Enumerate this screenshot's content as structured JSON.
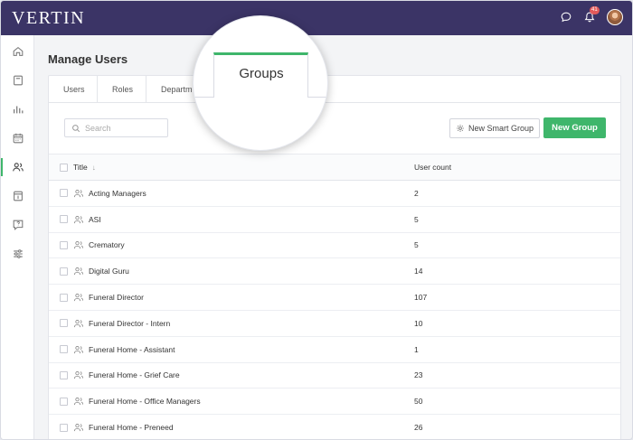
{
  "app": {
    "brand": "VERTIN",
    "notification_count": "41"
  },
  "colors": {
    "topbar": "#3b3466",
    "accent": "#3fb66b"
  },
  "sidebar": {
    "items": [
      {
        "icon": "home-icon",
        "active": false
      },
      {
        "icon": "book-icon",
        "active": false
      },
      {
        "icon": "bar-chart-icon",
        "active": false
      },
      {
        "icon": "calendar-icon",
        "active": false
      },
      {
        "icon": "users-icon",
        "active": true
      },
      {
        "icon": "calendar-day-icon",
        "active": false
      },
      {
        "icon": "help-icon",
        "active": false
      },
      {
        "icon": "sliders-icon",
        "active": false
      }
    ]
  },
  "page": {
    "title": "Manage Users"
  },
  "tabs": [
    {
      "label": "Users"
    },
    {
      "label": "Roles"
    },
    {
      "label": "Departm"
    }
  ],
  "magnified_tab": {
    "label": "Groups"
  },
  "search": {
    "placeholder": "Search"
  },
  "buttons": {
    "smart_group": "New Smart Group",
    "new_group": "New Group"
  },
  "table": {
    "headers": {
      "title": "Title",
      "count": "User count"
    },
    "rows": [
      {
        "title": "Acting Managers",
        "count": "2"
      },
      {
        "title": "ASI",
        "count": "5"
      },
      {
        "title": "Crematory",
        "count": "5"
      },
      {
        "title": "Digital Guru",
        "count": "14"
      },
      {
        "title": "Funeral Director",
        "count": "107"
      },
      {
        "title": "Funeral Director - Intern",
        "count": "10"
      },
      {
        "title": "Funeral Home - Assistant",
        "count": "1"
      },
      {
        "title": "Funeral Home - Grief Care",
        "count": "23"
      },
      {
        "title": "Funeral Home - Office Managers",
        "count": "50"
      },
      {
        "title": "Funeral Home - Preneed",
        "count": "26"
      }
    ]
  }
}
